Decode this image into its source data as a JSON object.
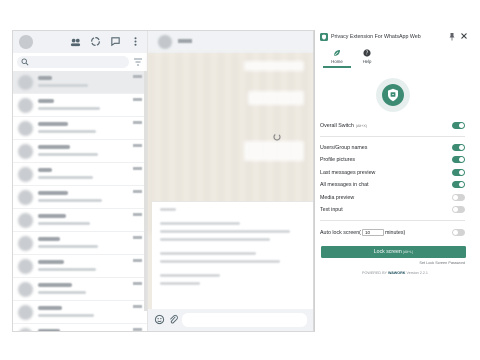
{
  "extension": {
    "title": "Privacy Extension For WhatsApp Web",
    "tabs": [
      {
        "label": "Home",
        "icon": "leaf-icon",
        "active": true
      },
      {
        "label": "Help",
        "icon": "help-icon",
        "active": false
      }
    ],
    "overall_switch": {
      "label": "Overall Switch",
      "shortcut": "(Alt+X)",
      "on": true
    },
    "options": [
      {
        "label": "Users/Group names",
        "on": true
      },
      {
        "label": "Profile pictures",
        "on": true
      },
      {
        "label": "Last messages preview",
        "on": true
      },
      {
        "label": "All messages in chat",
        "on": true
      },
      {
        "label": "Media preview",
        "on": false
      },
      {
        "label": "Text input",
        "on": false
      }
    ],
    "auto_lock": {
      "label": "Auto lock screen",
      "value": "10",
      "unit": "minutes)",
      "on": false
    },
    "lock_button": {
      "label": "Lock screen",
      "shortcut": "(Alt+L)"
    },
    "set_password_link": "Set Lock Screen Password",
    "footer": {
      "prefix": "POWERED BY",
      "brand": "WAWORK",
      "version": "Version 2.2.1"
    }
  },
  "colors": {
    "accent": "#3d8b73",
    "toggle_off": "#d3d3d3",
    "brand": "#1a4d5c"
  }
}
